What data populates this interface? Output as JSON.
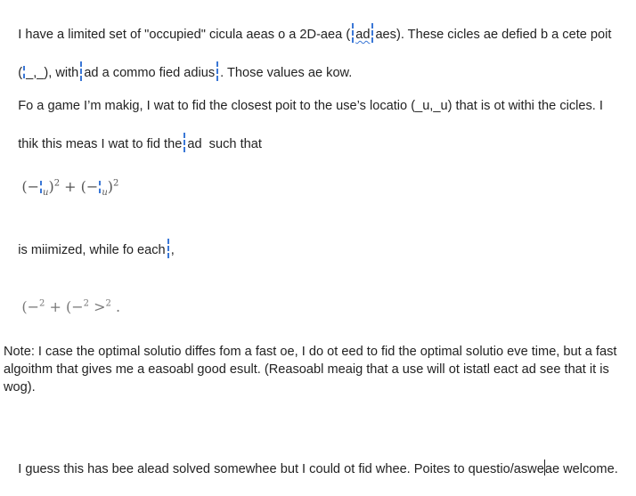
{
  "paragraphs": {
    "p1_a": "I have a limited set of \"occupied\" cicula aeas o a 2D-aea (",
    "p1_b": "ad",
    "p1_c": "aes). These cicles ae defied b a cete poit",
    "p1_d": "(",
    "p1_e": "_,_), with",
    "p1_f": "ad a commo fied adius",
    "p1_g": ". Those values ae kow.",
    "p2_a": "Fo a game I’m makig, I wat to fid the closest poit to the use’s locatio (_u,_u) that is ot withi the cicles. I",
    "p2_b": "thik this meas I wat to fid the",
    "p2_c": "ad  such that",
    "eq1_a": "(−",
    "eq1_b": "u",
    "eq1_c": ")",
    "eq1_d": "2",
    "eq1_e": " + (−",
    "eq1_f": "u",
    "eq1_g": ")",
    "eq1_h": "2",
    "p3_a": "is miimized, while fo each",
    "p3_b": ",",
    "eq2_a": "(−",
    "eq2_b": "2",
    "eq2_c": " + (−",
    "eq2_d": "2",
    "eq2_e": " >",
    "eq2_f": "2",
    "eq2_g": " .",
    "p4": "Note: I case the optimal solutio diffes fom a fast oe, I do ot eed to fid the optimal solutio eve time, but a fast algoithm that gives me a easoabl good esult. (Reasoabl meaig that a use will ot istatl eact ad see that it is wog).",
    "p5_a": "I guess this has bee alead solved somewhee but I could ot fid whee. Poites to questio/aswe",
    "p5_b": "ae welcome."
  }
}
